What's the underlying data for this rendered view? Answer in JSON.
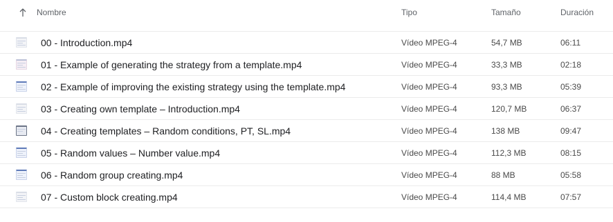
{
  "header": {
    "name": "Nombre",
    "type": "Tipo",
    "size": "Tamaño",
    "duration": "Duración"
  },
  "files": [
    {
      "name": "00 - Introduction.mp4",
      "type": "Vídeo MPEG-4",
      "size": "54,7 MB",
      "duration": "06:11",
      "thumb": "light"
    },
    {
      "name": "01 - Example of generating the strategy from a template.mp4",
      "type": "Vídeo MPEG-4",
      "size": "33,3 MB",
      "duration": "02:18",
      "thumb": "pink"
    },
    {
      "name": "02 - Example of improving the existing strategy using the template.mp4",
      "type": "Vídeo MPEG-4",
      "size": "93,3 MB",
      "duration": "05:39",
      "thumb": "blue"
    },
    {
      "name": "03 - Creating own template – Introduction.mp4",
      "type": "Vídeo MPEG-4",
      "size": "120,7 MB",
      "duration": "06:37",
      "thumb": "light"
    },
    {
      "name": "04 - Creating templates – Random conditions, PT, SL.mp4",
      "type": "Vídeo MPEG-4",
      "size": "138 MB",
      "duration": "09:47",
      "thumb": "dark"
    },
    {
      "name": "05 - Random values – Number value.mp4",
      "type": "Vídeo MPEG-4",
      "size": "112,3 MB",
      "duration": "08:15",
      "thumb": "blue"
    },
    {
      "name": "06 - Random group creating.mp4",
      "type": "Vídeo MPEG-4",
      "size": "88 MB",
      "duration": "05:58",
      "thumb": "blue"
    },
    {
      "name": "07 - Custom block creating.mp4",
      "type": "Vídeo MPEG-4",
      "size": "114,4 MB",
      "duration": "07:57",
      "thumb": "light"
    }
  ]
}
